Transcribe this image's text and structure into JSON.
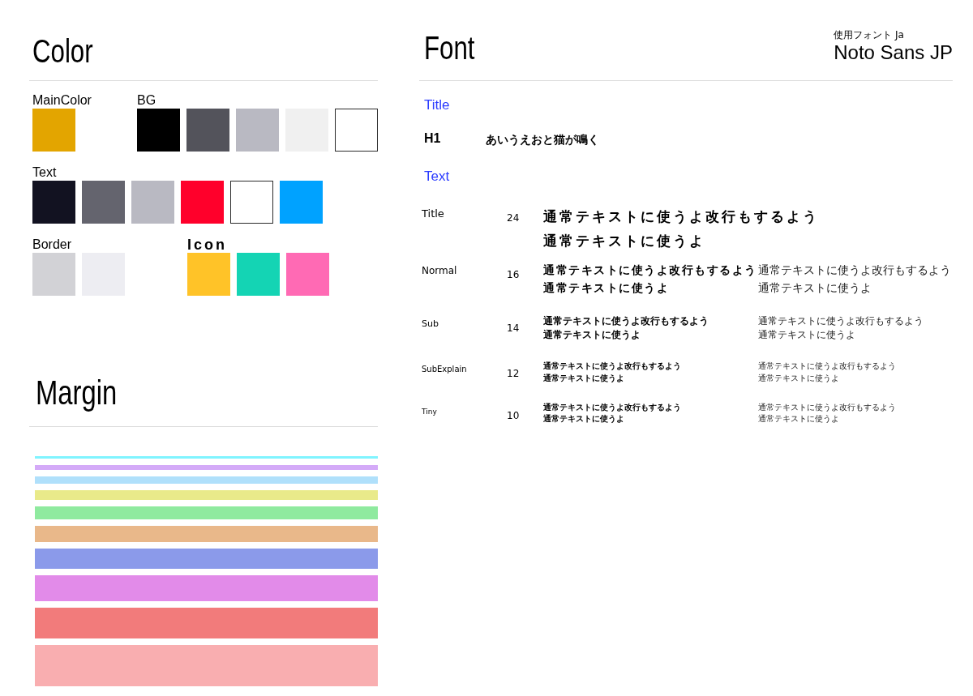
{
  "color": {
    "title": "Color",
    "groups": [
      {
        "label": "MainColor",
        "swatches": [
          {
            "color": "#e3a500",
            "outlined": false
          }
        ]
      },
      {
        "label": "BG",
        "swatches": [
          {
            "color": "#000000",
            "outlined": false
          },
          {
            "color": "#53535b",
            "outlined": false
          },
          {
            "color": "#b9b9c2",
            "outlined": false
          },
          {
            "color": "#f0f0f0",
            "outlined": false
          },
          {
            "color": "#ffffff",
            "outlined": true
          }
        ]
      },
      {
        "label": "Text",
        "swatches": [
          {
            "color": "#121221",
            "outlined": false
          },
          {
            "color": "#64646e",
            "outlined": false
          },
          {
            "color": "#b9b9c2",
            "outlined": false
          },
          {
            "color": "#ff002b",
            "outlined": false
          },
          {
            "color": "#ffffff",
            "outlined": true
          },
          {
            "color": "#00a2ff",
            "outlined": false
          }
        ]
      },
      {
        "label": "Border",
        "swatches": [
          {
            "color": "#d2d2d6",
            "outlined": false
          },
          {
            "color": "#ededf2",
            "outlined": false
          }
        ]
      },
      {
        "label": "Icon",
        "swatches": [
          {
            "color": "#ffc328",
            "outlined": false
          },
          {
            "color": "#14d4b4",
            "outlined": false
          },
          {
            "color": "#ff6ab4",
            "outlined": false
          }
        ]
      }
    ]
  },
  "margin": {
    "title": "Margin",
    "bars": [
      {
        "color": "#80f4ff"
      },
      {
        "color": "#d4aaf8"
      },
      {
        "color": "#b0e0fb"
      },
      {
        "color": "#e9ea8a"
      },
      {
        "color": "#8fea9f"
      },
      {
        "color": "#e9b88a"
      },
      {
        "color": "#8b9aea"
      },
      {
        "color": "#e28be9"
      },
      {
        "color": "#f27b7b"
      },
      {
        "color": "#f9aeb0"
      }
    ]
  },
  "font": {
    "title": "Font",
    "font_caption": "使用フォント Ja",
    "font_name": "Noto Sans JP",
    "title_heading": "Title",
    "h1": {
      "label": "H1",
      "sample": "あいうえおと猫が鳴く"
    },
    "text_heading": "Text",
    "rows": [
      {
        "label": "Title",
        "size": "24",
        "bold": [
          "通常テキストに使うよ改行もするよう",
          "通常テキストに使うよ"
        ]
      },
      {
        "label": "Normal",
        "size": "16",
        "bold": [
          "通常テキストに使うよ改行もするよう",
          "通常テキストに使うよ"
        ],
        "regular": [
          "通常テキストに使うよ改行もするよう",
          "通常テキストに使うよ"
        ]
      },
      {
        "label": "Sub",
        "size": "14",
        "bold": [
          "通常テキストに使うよ改行もするよう",
          "通常テキストに使うよ"
        ],
        "regular": [
          "通常テキストに使うよ改行もするよう",
          "通常テキストに使うよ"
        ]
      },
      {
        "label": "SubExplain",
        "size": "12",
        "bold": [
          "通常テキストに使うよ改行もするよう",
          "通常テキストに使うよ"
        ],
        "regular": [
          "通常テキストに使うよ改行もするよう",
          "通常テキストに使うよ"
        ]
      },
      {
        "label": "Tiny",
        "size": "10",
        "bold": [
          "通常テキストに使うよ改行もするよう",
          "通常テキストに使うよ"
        ],
        "regular": [
          "通常テキストに使うよ改行もするよう",
          "通常テキストに使うよ"
        ]
      }
    ]
  }
}
